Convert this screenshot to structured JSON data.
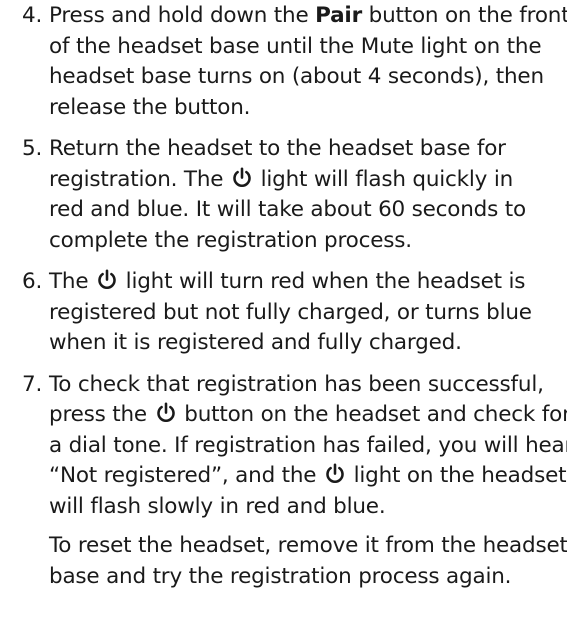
{
  "steps": [
    {
      "number": "4.",
      "lines": [
        {
          "before": "Press and hold down the ",
          "bold": "Pair",
          "after": " button on the front"
        },
        {
          "text": "of the headset base until the Mute light on the"
        },
        {
          "text": "headset base turns on (about 4 seconds), then"
        },
        {
          "text": "release the button."
        }
      ]
    },
    {
      "number": "5.",
      "lines": [
        {
          "text": "Return the headset to the headset base for"
        },
        {
          "before": "registration. The ",
          "after": " light will flash quickly in"
        },
        {
          "text": "red and blue. It will take about 60 seconds to"
        },
        {
          "text": "complete the registration process."
        }
      ]
    },
    {
      "number": "6.",
      "lines": [
        {
          "before": "The ",
          "after": " light will turn red when the headset is"
        },
        {
          "text": "registered but not fully charged, or turns blue"
        },
        {
          "text": "when it is registered and fully charged."
        }
      ]
    },
    {
      "number": "7.",
      "lines": [
        {
          "text": "To check that registration has been successful,"
        },
        {
          "before": "press the ",
          "after": " button on the headset and check for"
        },
        {
          "text": "a dial tone. If registration has failed, you will hear,"
        },
        {
          "before": "“Not registered”, and the ",
          "after": " light on the headset"
        },
        {
          "text": "will flash slowly in red and blue."
        }
      ],
      "note_lines": [
        "To reset the headset, remove it from the headset",
        "base and try the registration process again."
      ]
    }
  ],
  "icons": {
    "power": "power-icon"
  },
  "colors": {
    "text": "#1a1a1a",
    "background": "#ffffff"
  }
}
